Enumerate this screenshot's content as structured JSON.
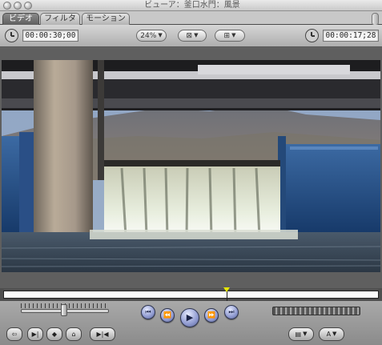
{
  "window": {
    "title": "ビューア：釜口水門：風景"
  },
  "tabs": [
    {
      "label": "ビデオ",
      "active": true
    },
    {
      "label": "フィルタ",
      "active": false
    },
    {
      "label": "モーション",
      "active": false
    }
  ],
  "toolbar": {
    "duration": "00:00:30;00",
    "zoom": "24%",
    "current_timecode": "00:00:17;28"
  },
  "video": {
    "description_icon": "video-frame"
  },
  "scrubber": {
    "playhead_fraction": 0.59,
    "playhead_color": "#e6e600"
  },
  "transport": {
    "icons": [
      "go-to-in-point-icon",
      "previous-edit-icon",
      "play-icon",
      "next-edit-icon",
      "go-to-out-point-icon"
    ]
  },
  "colors": {
    "transport_accent": "#8f9ad0",
    "active_tab": "#5f5f5f"
  }
}
